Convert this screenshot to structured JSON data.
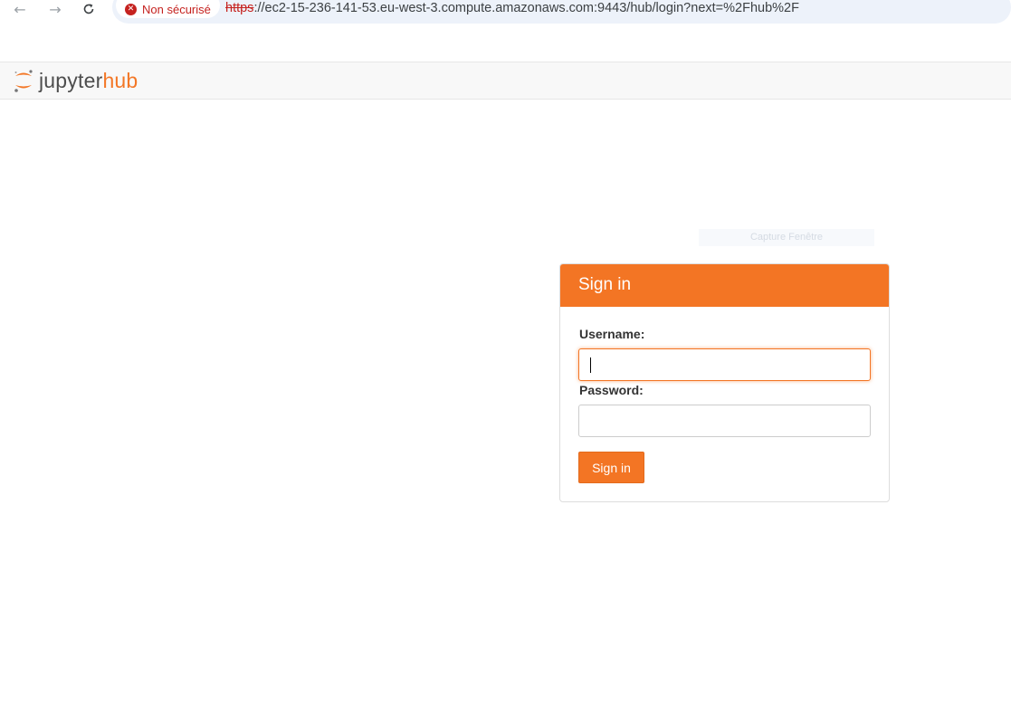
{
  "browser": {
    "security_label": "Non sécurisé",
    "url_scheme": "https",
    "url_rest": "://ec2-15-236-141-53.eu-west-3.compute.amazonaws.com:9443/hub/login?next=%2Fhub%2F"
  },
  "header": {
    "logo_part1": "jupyter",
    "logo_part2": "hub"
  },
  "overlay": {
    "ghost_text": "Capture Fenêtre"
  },
  "login": {
    "title": "Sign in",
    "username_label": "Username:",
    "username_value": "",
    "password_label": "Password:",
    "password_value": "",
    "submit_label": "Sign in"
  },
  "colors": {
    "brand_orange": "#f37524",
    "security_red": "#c5221f"
  }
}
